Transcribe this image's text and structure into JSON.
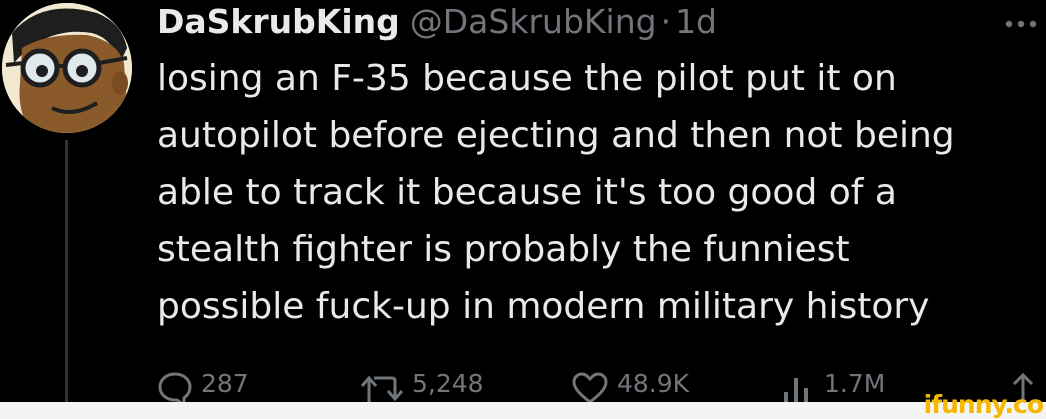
{
  "tweet": {
    "display_name": "DaSkrubKing",
    "handle": "@DaSkrubKing",
    "separator": "·",
    "time": "1d",
    "text": "losing an F-35 because the pilot put it on\nautopilot before ejecting and then not being\nable to track it because it's too good of a\nstealth fighter is probably the funniest\npossible fuck-up in modern military history"
  },
  "actions": {
    "replies": "287",
    "retweets": "5,248",
    "likes": "48.9K",
    "views": "1.7M"
  },
  "icons": {
    "more": "more-horizontal-icon",
    "reply": "reply-icon",
    "retweet": "retweet-icon",
    "like": "heart-icon",
    "views": "bar-chart-icon",
    "share": "share-icon"
  },
  "watermark": "ifunny.co",
  "colors": {
    "background": "#000000",
    "text": "#e7e9ea",
    "muted": "#71767b",
    "watermark": "#f5b800"
  }
}
